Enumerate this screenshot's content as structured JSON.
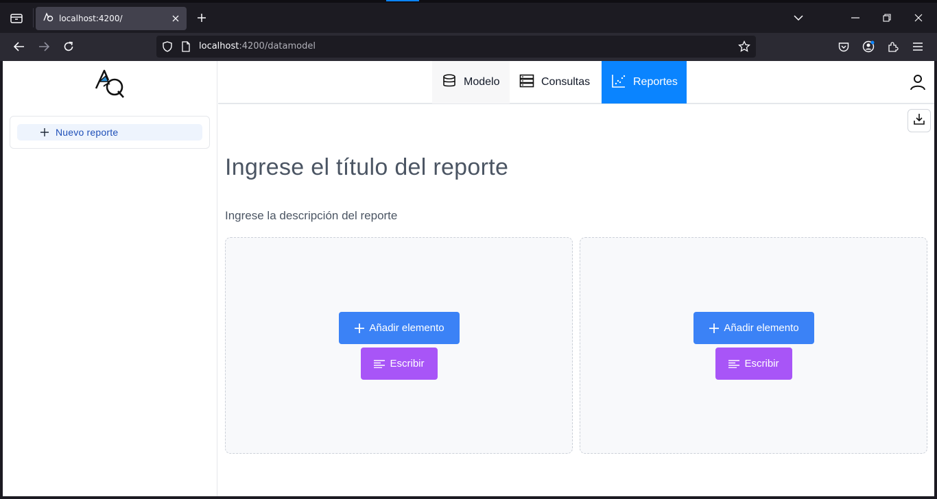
{
  "browser": {
    "tab_title": "localhost:4200/",
    "url_host": "localhost",
    "url_path": ":4200/datamodel"
  },
  "nav": {
    "tabs": [
      {
        "label": "Modelo",
        "icon": "database-icon"
      },
      {
        "label": "Consultas",
        "icon": "server-icon"
      },
      {
        "label": "Reportes",
        "icon": "chart-scatter-icon"
      }
    ],
    "active_tab": "Reportes",
    "accent_color": "#0a84ff"
  },
  "sidebar": {
    "new_report_label": "Nuevo reporte"
  },
  "report": {
    "title": "Ingrese el título del reporte",
    "description": "Ingrese la descripción del reporte"
  },
  "slots": [
    {
      "add_label": "Añadir elemento",
      "write_label": "Escribir"
    },
    {
      "add_label": "Añadir elemento",
      "write_label": "Escribir"
    }
  ],
  "colors": {
    "add_button": "#3b82f6",
    "write_button": "#a855f7"
  }
}
